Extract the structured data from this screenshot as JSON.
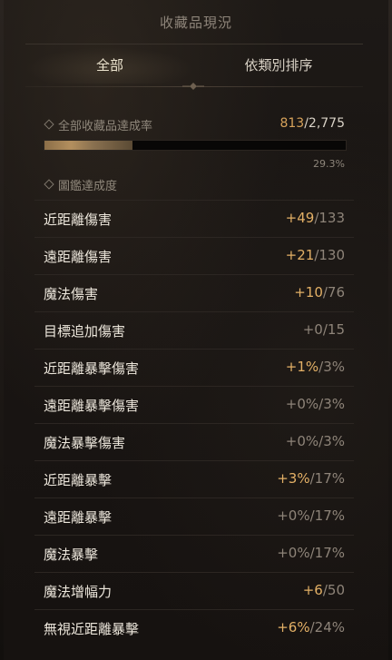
{
  "header": {
    "title": "收藏品現況"
  },
  "tabs": [
    {
      "label": "全部",
      "active": true
    },
    {
      "label": "依類別排序",
      "active": false
    }
  ],
  "summary": {
    "label": "全部收藏品達成率",
    "current": "813",
    "total_text": "/2,775",
    "progress_fraction": 0.293,
    "percent_text": "29.3%"
  },
  "codex": {
    "label": "圖鑑達成度"
  },
  "stats": [
    {
      "name": "近距離傷害",
      "value": "+49",
      "max": "/133",
      "positive": true
    },
    {
      "name": "遠距離傷害",
      "value": "+21",
      "max": "/130",
      "positive": true
    },
    {
      "name": "魔法傷害",
      "value": "+10",
      "max": "/76",
      "positive": true
    },
    {
      "name": "目標追加傷害",
      "value": "+0",
      "max": "/15",
      "positive": false
    },
    {
      "name": "近距離暴擊傷害",
      "value": "+1%",
      "max": "/3%",
      "positive": true
    },
    {
      "name": "遠距離暴擊傷害",
      "value": "+0%",
      "max": "/3%",
      "positive": false
    },
    {
      "name": "魔法暴擊傷害",
      "value": "+0%",
      "max": "/3%",
      "positive": false
    },
    {
      "name": "近距離暴擊",
      "value": "+3%",
      "max": "/17%",
      "positive": true
    },
    {
      "name": "遠距離暴擊",
      "value": "+0%",
      "max": "/17%",
      "positive": false
    },
    {
      "name": "魔法暴擊",
      "value": "+0%",
      "max": "/17%",
      "positive": false
    },
    {
      "name": "魔法增幅力",
      "value": "+6",
      "max": "/50",
      "positive": true
    },
    {
      "name": "無視近距離暴擊",
      "value": "+6%",
      "max": "/24%",
      "positive": true
    }
  ],
  "colors": {
    "accent_gold": "#e3b066",
    "muted": "#8e8479",
    "background": "#191513"
  }
}
